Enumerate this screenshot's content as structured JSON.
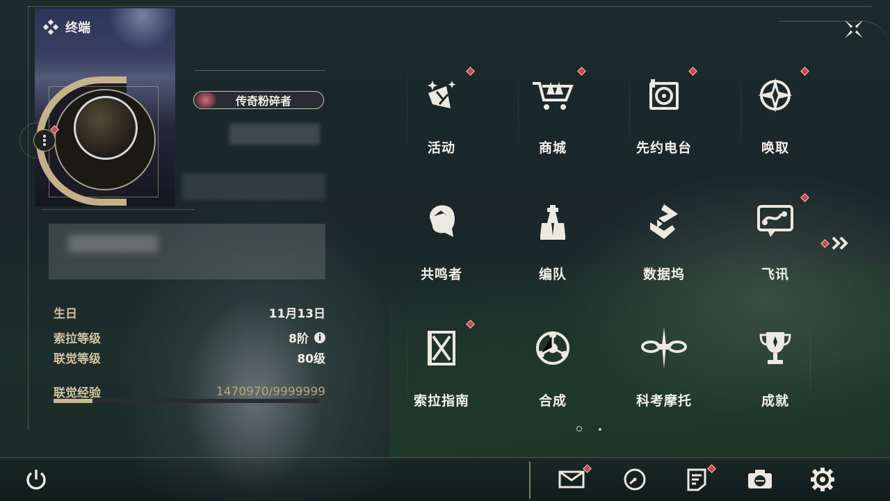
{
  "header": {
    "title": "终端"
  },
  "profile": {
    "title_badge": "传奇粉碎者",
    "birthday_label": "生日",
    "birthday_value": "11月13日",
    "sola_level_label": "索拉等级",
    "sola_level_value": "8阶",
    "union_level_label": "联觉等级",
    "union_level_value": "80级",
    "union_exp_label": "联觉经验",
    "union_exp_value": "1470970/9999999",
    "union_exp_progress": 0.147
  },
  "menu": {
    "items": [
      {
        "label": "活动",
        "icon": "event-icon",
        "badge": true
      },
      {
        "label": "商城",
        "icon": "shop-cart-icon",
        "badge": true
      },
      {
        "label": "先约电台",
        "icon": "radio-icon",
        "badge": true
      },
      {
        "label": "唤取",
        "icon": "summon-compass-icon",
        "badge": true
      },
      {
        "label": "共鸣者",
        "icon": "resonator-head-icon",
        "badge": false
      },
      {
        "label": "编队",
        "icon": "chess-team-icon",
        "badge": false
      },
      {
        "label": "数据坞",
        "icon": "data-dock-icon",
        "badge": false
      },
      {
        "label": "飞讯",
        "icon": "chat-message-icon",
        "badge": true
      },
      {
        "label": "索拉指南",
        "icon": "guide-book-icon",
        "badge": true
      },
      {
        "label": "合成",
        "icon": "synthesis-icon",
        "badge": false
      },
      {
        "label": "科考摩托",
        "icon": "motorbike-icon",
        "badge": false
      },
      {
        "label": "成就",
        "icon": "trophy-icon",
        "badge": false
      }
    ],
    "page_count": 2,
    "current_page": 1
  },
  "bottom_bar": {
    "buttons": [
      "power-icon",
      "mail-icon",
      "clock-icon",
      "notice-icon",
      "camera-icon",
      "settings-gear-icon"
    ]
  },
  "colors": {
    "accent_gold": "#cdb88d",
    "badge_red": "#d1434f",
    "text_light": "#f3f1ea"
  }
}
